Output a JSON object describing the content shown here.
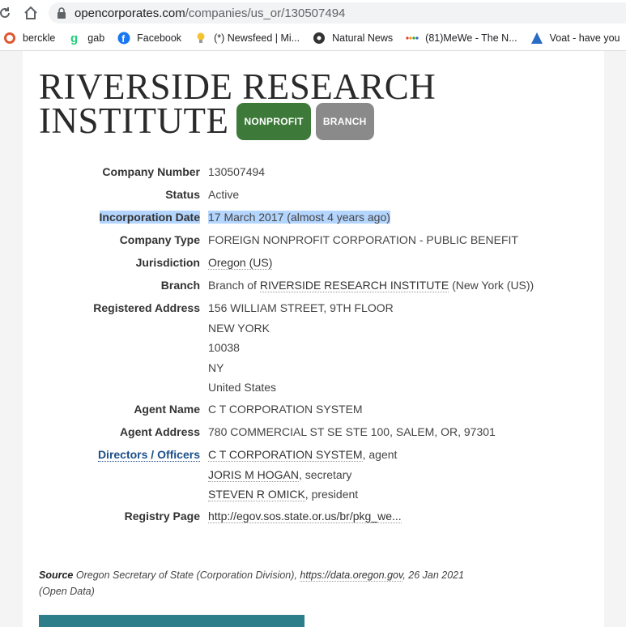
{
  "browser": {
    "url_domain": "opencorporates.com",
    "url_path": "/companies/us_or/130507494",
    "bookmarks": [
      {
        "label": "berckle"
      },
      {
        "label": "gab"
      },
      {
        "label": "Facebook"
      },
      {
        "label": "(*) Newsfeed | Mi..."
      },
      {
        "label": "Natural News"
      },
      {
        "label": "(81)MeWe - The N..."
      },
      {
        "label": "Voat - have you"
      }
    ]
  },
  "company": {
    "name_line1": "RIVERSIDE RESEARCH",
    "name_line2": "INSTITUTE",
    "badge_nonprofit": "NONPROFIT",
    "badge_branch": "BRANCH"
  },
  "details": {
    "company_number": {
      "label": "Company Number",
      "value": "130507494"
    },
    "status": {
      "label": "Status",
      "value": "Active"
    },
    "incorporation_date": {
      "label": "Incorporation Date",
      "value": "17 March 2017 (almost 4 years ago)"
    },
    "company_type": {
      "label": "Company Type",
      "value": "FOREIGN NONPROFIT CORPORATION - PUBLIC BENEFIT"
    },
    "jurisdiction": {
      "label": "Jurisdiction",
      "value": "Oregon (US)"
    },
    "branch": {
      "label": "Branch",
      "prefix": "Branch of ",
      "link": "RIVERSIDE RESEARCH INSTITUTE",
      "suffix": " (New York (US))"
    },
    "registered_address": {
      "label": "Registered Address",
      "lines": [
        "156 WILLIAM STREET, 9TH FLOOR",
        "NEW YORK",
        "10038",
        "NY",
        "United States"
      ]
    },
    "agent_name": {
      "label": "Agent Name",
      "value": "C T CORPORATION SYSTEM"
    },
    "agent_address": {
      "label": "Agent Address",
      "value": "780 COMMERCIAL ST SE STE 100, SALEM, OR, 97301"
    },
    "directors": {
      "label": "Directors / Officers",
      "people": [
        {
          "name": "C T CORPORATION SYSTEM",
          "role": ", agent"
        },
        {
          "name": "JORIS M HOGAN",
          "role": ", secretary"
        },
        {
          "name": "STEVEN R OMICK",
          "role": ", president"
        }
      ]
    },
    "registry_page": {
      "label": "Registry Page",
      "value": "http://egov.sos.state.or.us/br/pkg_we..."
    }
  },
  "source": {
    "label": "Source",
    "text": " Oregon Secretary of State (Corporation Division), ",
    "link": "https://data.oregon.gov",
    "date": ", 26 Jan 2021",
    "license": "(Open Data)"
  },
  "colors": {
    "nonprofit_badge": "#3d7a3a",
    "branch_badge": "#8a8a8a",
    "selection_highlight": "#b4d5fe",
    "link_blue": "#1b4f8a"
  }
}
